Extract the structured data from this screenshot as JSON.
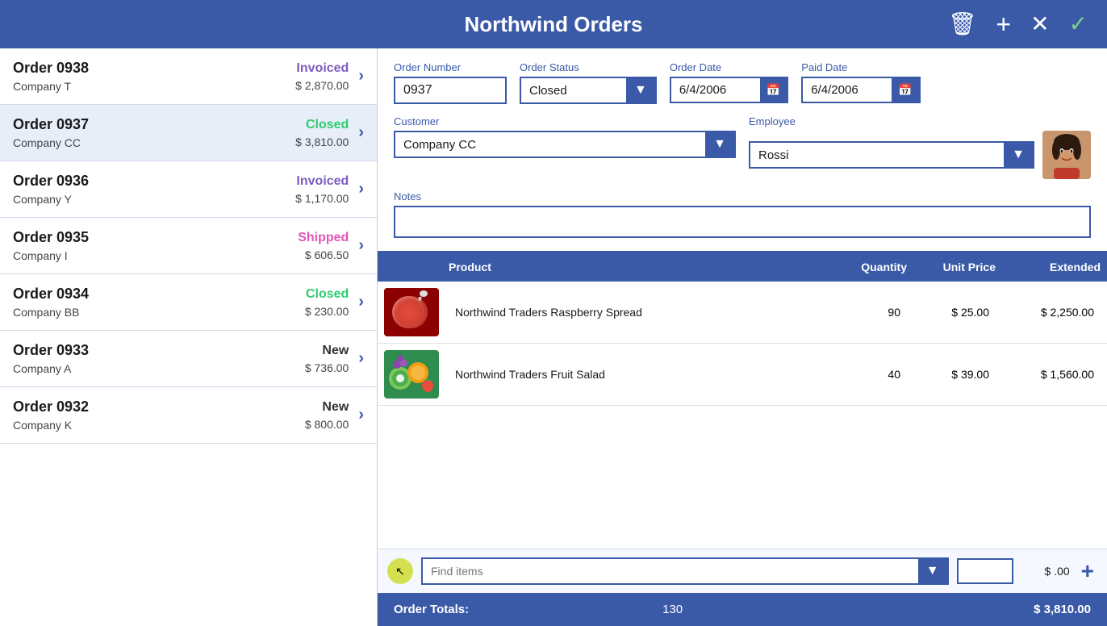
{
  "header": {
    "title": "Northwind Orders",
    "delete_label": "🗑",
    "add_label": "+",
    "close_label": "✕",
    "confirm_label": "✓"
  },
  "orders": [
    {
      "id": "Order 0938",
      "company": "Company T",
      "status": "Invoiced",
      "status_class": "status-invoiced",
      "amount": "$ 2,870.00"
    },
    {
      "id": "Order 0937",
      "company": "Company CC",
      "status": "Closed",
      "status_class": "status-closed",
      "amount": "$ 3,810.00"
    },
    {
      "id": "Order 0936",
      "company": "Company Y",
      "status": "Invoiced",
      "status_class": "status-invoiced",
      "amount": "$ 1,170.00"
    },
    {
      "id": "Order 0935",
      "company": "Company I",
      "status": "Shipped",
      "status_class": "status-shipped",
      "amount": "$ 606.50"
    },
    {
      "id": "Order 0934",
      "company": "Company BB",
      "status": "Closed",
      "status_class": "status-closed",
      "amount": "$ 230.00"
    },
    {
      "id": "Order 0933",
      "company": "Company A",
      "status": "New",
      "status_class": "status-new",
      "amount": "$ 736.00"
    },
    {
      "id": "Order 0932",
      "company": "Company K",
      "status": "New",
      "status_class": "status-new",
      "amount": "$ 800.00"
    }
  ],
  "detail": {
    "order_number_label": "Order Number",
    "order_number": "0937",
    "order_status_label": "Order Status",
    "order_status": "Closed",
    "order_date_label": "Order Date",
    "order_date": "6/4/2006",
    "paid_date_label": "Paid Date",
    "paid_date": "6/4/2006",
    "customer_label": "Customer",
    "customer": "Company CC",
    "employee_label": "Employee",
    "employee": "Rossi",
    "notes_label": "Notes",
    "notes": ""
  },
  "table": {
    "col_product": "Product",
    "col_quantity": "Quantity",
    "col_unit_price": "Unit Price",
    "col_extended": "Extended",
    "products": [
      {
        "name": "Northwind Traders Raspberry Spread",
        "quantity": "90",
        "unit_price": "$ 25.00",
        "extended": "$ 2,250.00",
        "img_type": "raspberry"
      },
      {
        "name": "Northwind Traders Fruit Salad",
        "quantity": "40",
        "unit_price": "$ 39.00",
        "extended": "$ 1,560.00",
        "img_type": "fruitsalad"
      }
    ]
  },
  "add_item": {
    "find_placeholder": "Find items",
    "qty_value": "",
    "price": "$ .00",
    "add_btn": "+"
  },
  "totals": {
    "label": "Order Totals:",
    "quantity": "130",
    "amount": "$ 3,810.00"
  }
}
